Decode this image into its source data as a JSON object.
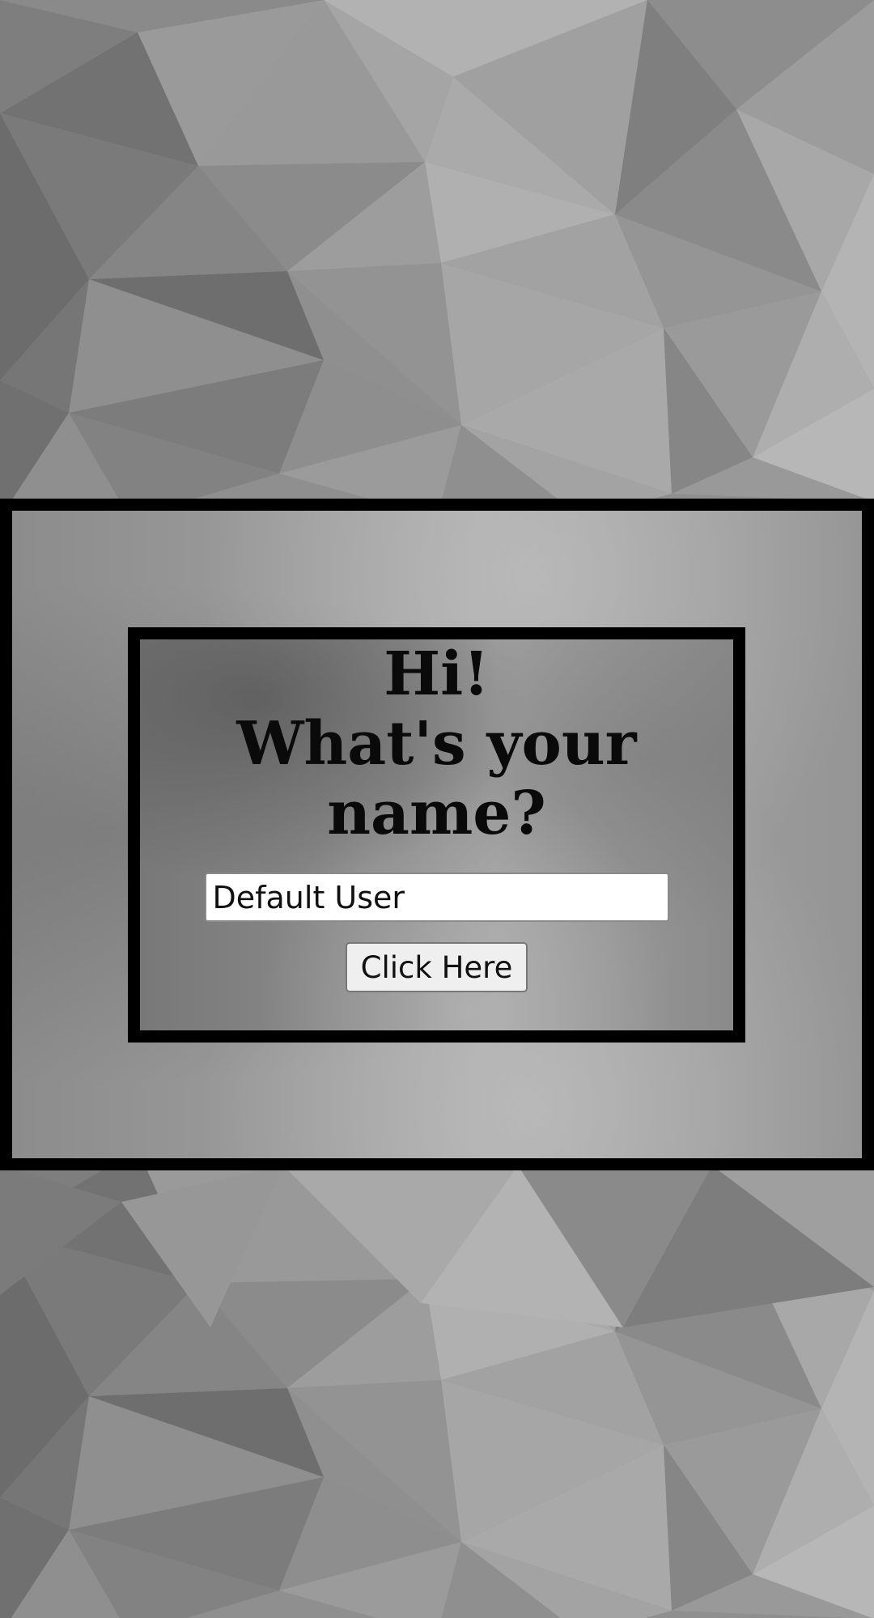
{
  "prompt": {
    "line1": "Hi!",
    "line2": "What's your",
    "line3": "name?"
  },
  "name_input": {
    "value": "Default User"
  },
  "submit_button": {
    "label": "Click Here"
  },
  "colors": {
    "frame_border": "#000000",
    "input_background": "#ffffff",
    "button_background": "#efefef"
  }
}
